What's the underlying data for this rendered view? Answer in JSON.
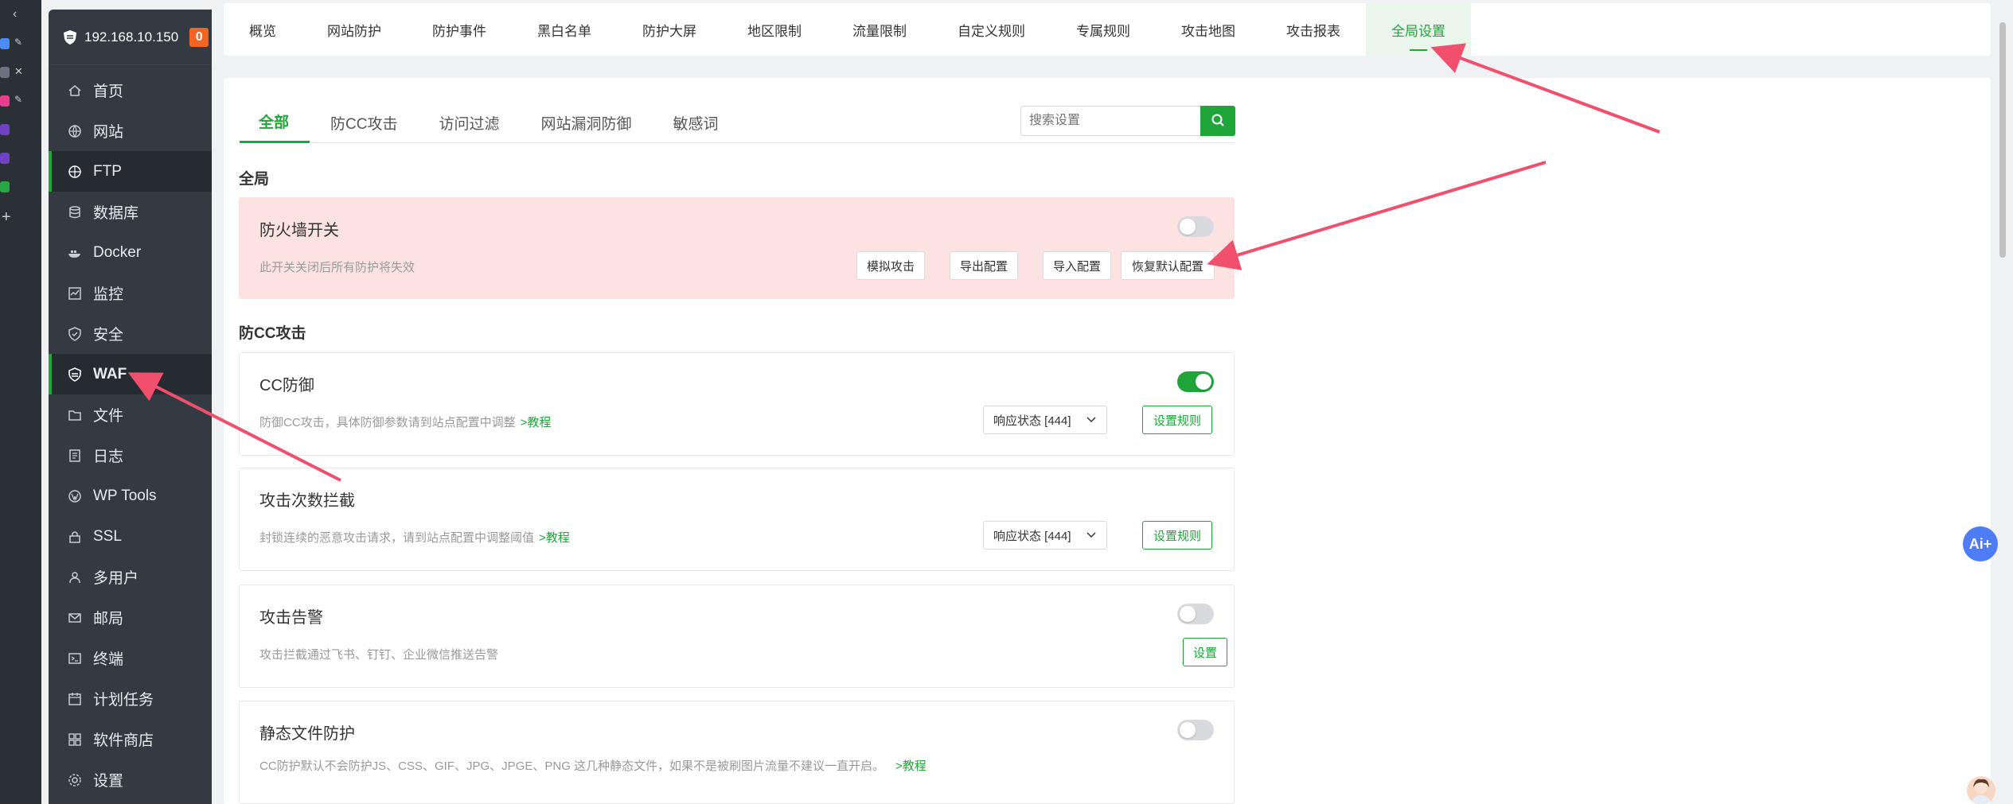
{
  "server": {
    "ip": "192.168.10.150",
    "badge": "0"
  },
  "sidebar": {
    "items": [
      {
        "label": "首页",
        "icon": "home-icon"
      },
      {
        "label": "网站",
        "icon": "globe-icon"
      },
      {
        "label": "FTP",
        "icon": "ftp-icon"
      },
      {
        "label": "数据库",
        "icon": "database-icon"
      },
      {
        "label": "Docker",
        "icon": "docker-icon"
      },
      {
        "label": "监控",
        "icon": "monitor-icon"
      },
      {
        "label": "安全",
        "icon": "shield-icon"
      },
      {
        "label": "WAF",
        "icon": "waf-icon"
      },
      {
        "label": "文件",
        "icon": "folder-icon"
      },
      {
        "label": "日志",
        "icon": "log-icon"
      },
      {
        "label": "WP Tools",
        "icon": "wordpress-icon"
      },
      {
        "label": "SSL",
        "icon": "ssl-icon"
      },
      {
        "label": "多用户",
        "icon": "users-icon"
      },
      {
        "label": "邮局",
        "icon": "mail-icon"
      },
      {
        "label": "终端",
        "icon": "terminal-icon"
      },
      {
        "label": "计划任务",
        "icon": "calendar-icon"
      },
      {
        "label": "软件商店",
        "icon": "apps-icon"
      },
      {
        "label": "设置",
        "icon": "gear-icon"
      }
    ]
  },
  "topnav": {
    "tabs": [
      "概览",
      "网站防护",
      "防护事件",
      "黑白名单",
      "防护大屏",
      "地区限制",
      "流量限制",
      "自定义规则",
      "专属规则",
      "攻击地图",
      "攻击报表",
      "全局设置"
    ]
  },
  "subtabs": [
    "全部",
    "防CC攻击",
    "访问过滤",
    "网站漏洞防御",
    "敏感词"
  ],
  "search": {
    "placeholder": "搜索设置"
  },
  "global": {
    "title": "全局",
    "firewall": {
      "title": "防火墙开关",
      "desc": "此开关关闭后所有防护将失效",
      "buttons": [
        "模拟攻击",
        "导出配置",
        "导入配置",
        "恢复默认配置"
      ]
    }
  },
  "cc": {
    "title": "防CC攻击",
    "cards": [
      {
        "title": "CC防御",
        "desc": "防御CC攻击，具体防御参数请到站点配置中调整",
        "link": ">教程",
        "select": "响应状态 [444]",
        "button": "设置规则"
      },
      {
        "title": "攻击次数拦截",
        "desc": "封锁连续的恶意攻击请求，请到站点配置中调整阈值",
        "link": ">教程",
        "select": "响应状态 [444]",
        "button": "设置规则"
      },
      {
        "title": "攻击告警",
        "desc": "攻击拦截通过飞书、钉钉、企业微信推送告警",
        "button": "设置"
      },
      {
        "title": "静态文件防护",
        "desc": "CC防护默认不会防护JS、CSS、GIF、JPG、JPGE、PNG 这几种静态文件，如果不是被刷图片流量不建议一直开启。",
        "link": ">教程"
      }
    ]
  },
  "fab": {
    "label": "Ai+"
  },
  "colors": {
    "accent": "#20a53a",
    "sidebar": "#333a42",
    "badge": "#f26522",
    "warning_bg": "#fde2e2",
    "arrow": "#f0506e"
  }
}
